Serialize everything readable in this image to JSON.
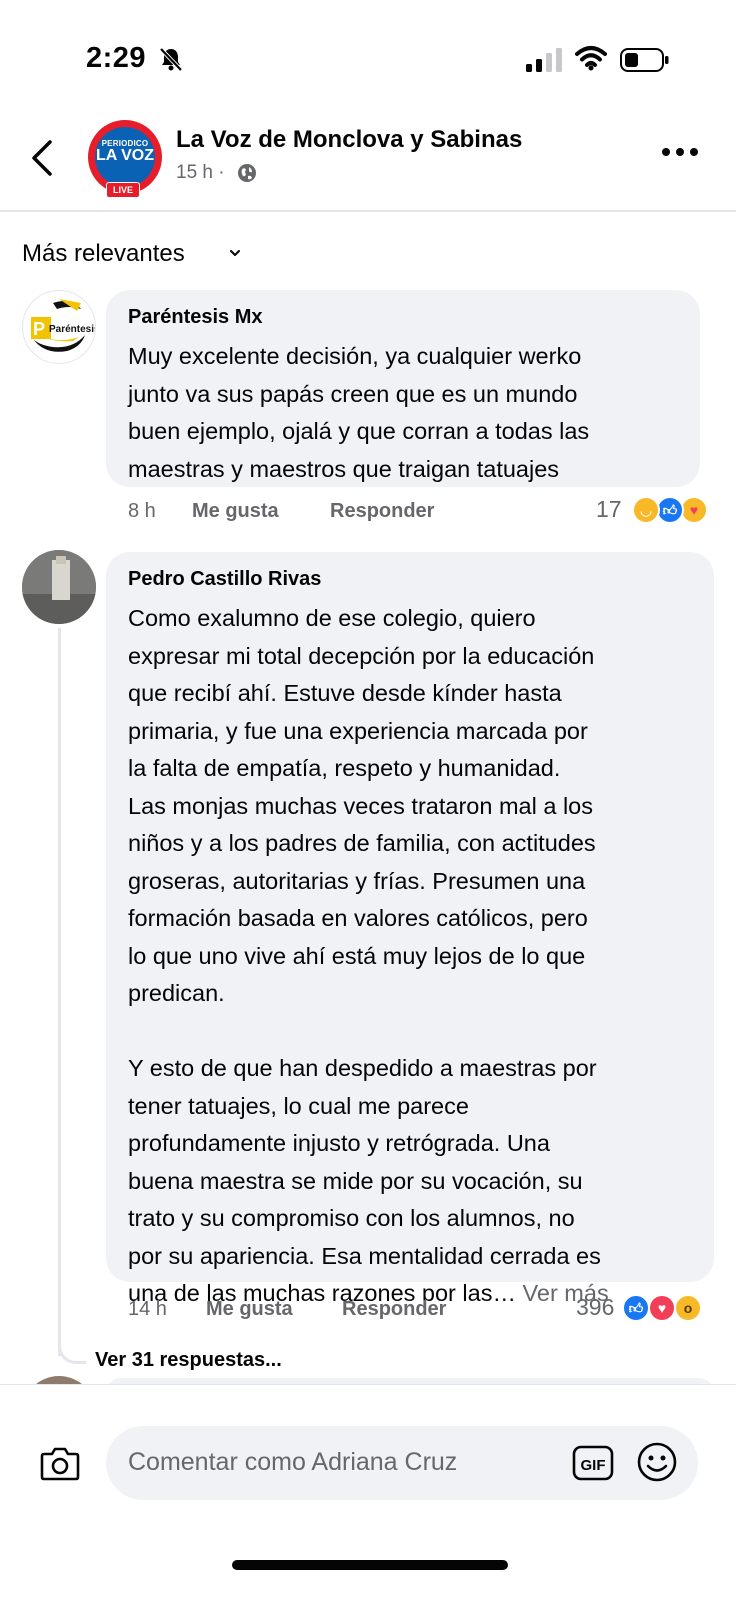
{
  "status_bar": {
    "time": "2:29"
  },
  "header": {
    "page_name": "La Voz de Monclova y Sabinas",
    "post_time": "15 h ·",
    "logo_line1": "PERIODICO",
    "logo_line2": "LA VOZ",
    "logo_live": "LIVE"
  },
  "filter": {
    "label": "Más relevantes"
  },
  "comments": [
    {
      "author": "Paréntesis Mx",
      "avatar_text": "Paréntesis",
      "text": "Muy excelente decisión, ya cualquier werko\njunto va sus papás creen que es un mundo\nbuen ejemplo, ojalá y que corran a todas las\nmaestras y maestros que traigan tatuajes",
      "time": "8 h",
      "like_label": "Me gusta",
      "reply_label": "Responder",
      "reaction_count": "17",
      "reactions": [
        "haha",
        "like",
        "care"
      ]
    },
    {
      "author": "Pedro Castillo Rivas",
      "text": "Como exalumno de ese colegio, quiero\nexpresar mi total decepción por la educación\nque recibí ahí. Estuve desde kínder hasta\nprimaria, y fue una experiencia marcada por\nla falta de empatía, respeto y humanidad.\nLas monjas muchas veces trataron mal a los\nniños y a los padres de familia, con actitudes\ngroseras, autoritarias y frías. Presumen una\nformación basada en valores católicos, pero\nlo que uno vive ahí está muy lejos de lo que\npredican.\n\nY esto de que han despedido a maestras por\ntener tatuajes, lo cual me parece\nprofundamente injusto y retrógrada. Una\nbuena maestra se mide por su vocación, su\ntrato y su compromiso con los alumnos, no\npor su apariencia. Esa mentalidad cerrada es\nuna de las muchas razones por las…",
      "see_more": "Ver más",
      "time": "14 h",
      "like_label": "Me gusta",
      "reply_label": "Responder",
      "reaction_count": "396",
      "reactions": [
        "like",
        "love",
        "wow"
      ],
      "replies_label": "Ver 31 respuestas..."
    }
  ],
  "composer": {
    "placeholder": "Comentar como Adriana Cruz",
    "gif_label": "GIF"
  },
  "colors": {
    "accent": "#1877f2",
    "bubble": "#f0f2f5",
    "secondary_text": "#65676b",
    "love": "#f33e58",
    "haha": "#f7b928"
  }
}
